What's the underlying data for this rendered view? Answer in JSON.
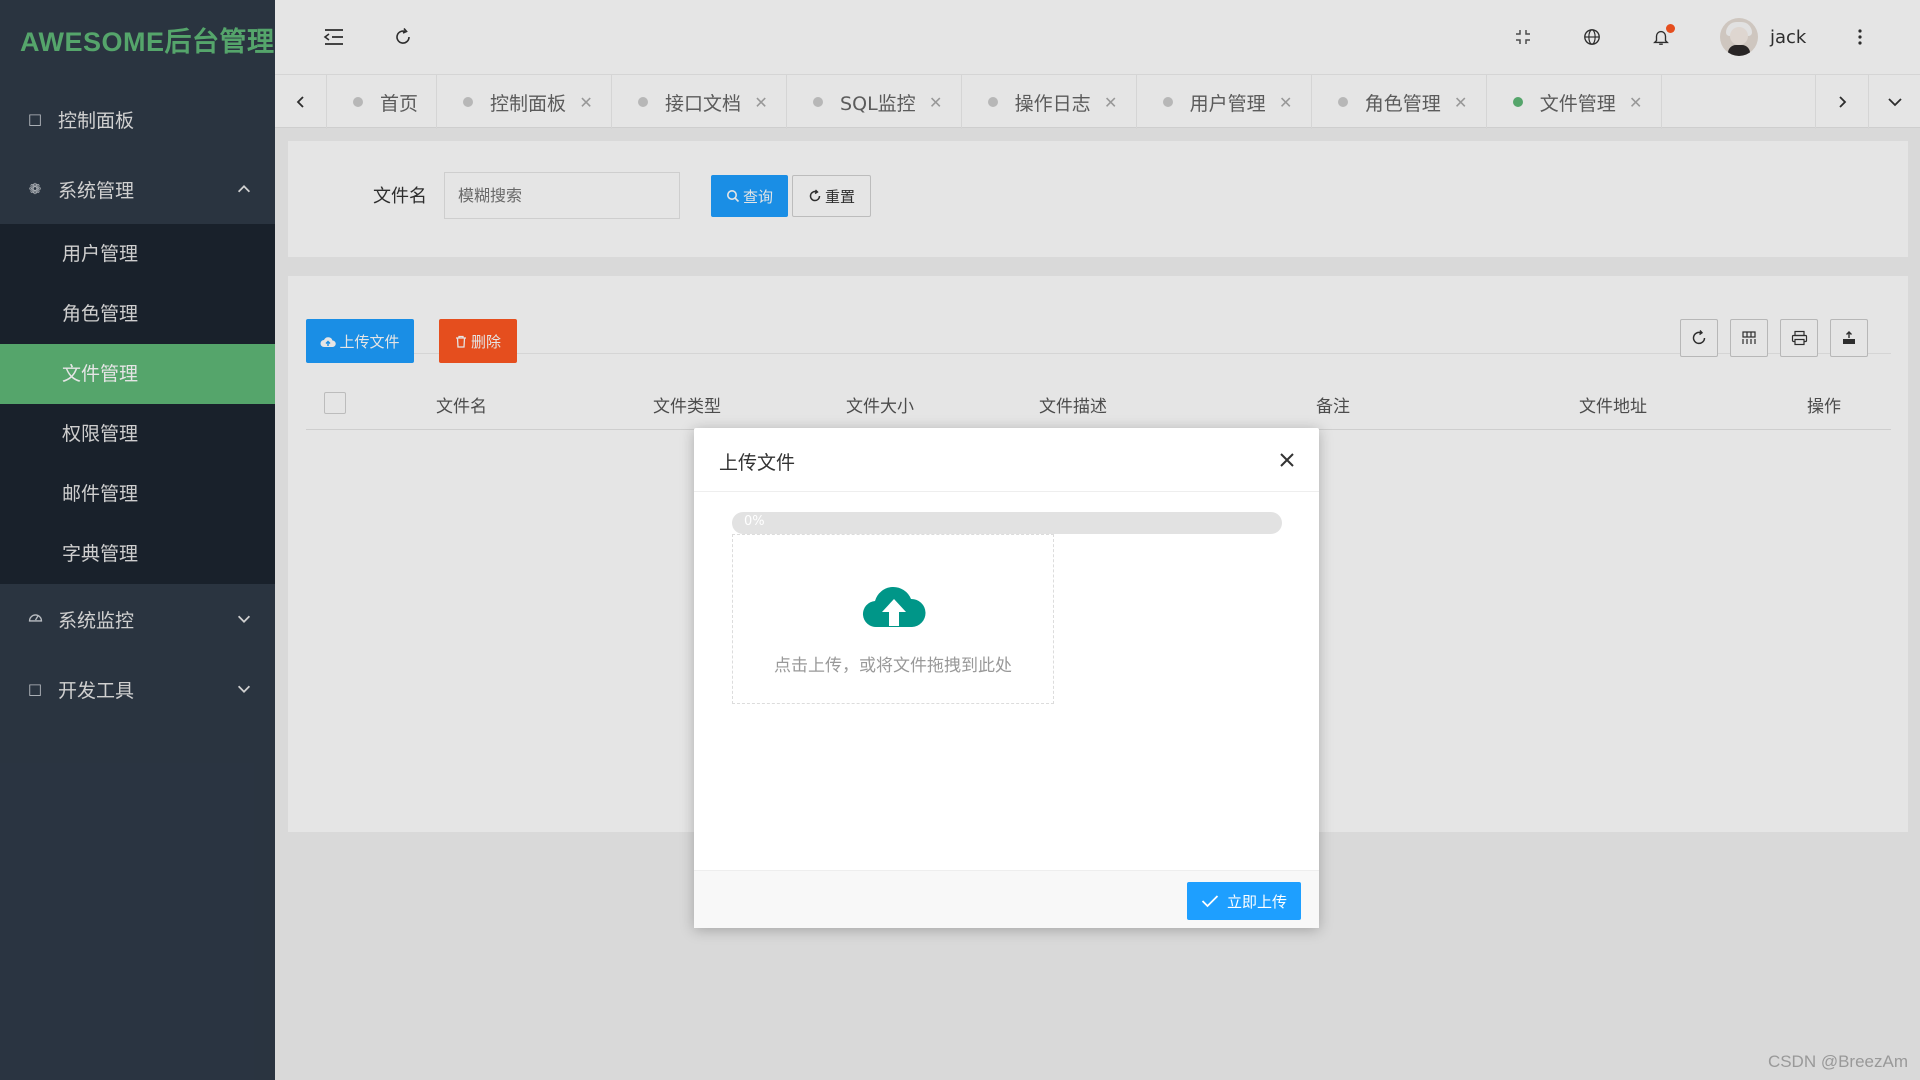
{
  "app": {
    "logo": "AWESOME后台管理"
  },
  "sidebar": {
    "items": [
      {
        "label": "控制面板",
        "icon": "square-icon"
      },
      {
        "label": "系统管理",
        "icon": "gear-icon",
        "expanded": true,
        "children": [
          "用户管理",
          "角色管理",
          "文件管理",
          "权限管理",
          "邮件管理",
          "字典管理"
        ],
        "active_child": "文件管理"
      },
      {
        "label": "系统监控",
        "icon": "dashboard-icon"
      },
      {
        "label": "开发工具",
        "icon": "square-icon"
      }
    ]
  },
  "header": {
    "username": "jack",
    "notification_dot": true
  },
  "tabs": [
    {
      "label": "首页",
      "closable": false
    },
    {
      "label": "控制面板",
      "closable": true
    },
    {
      "label": "接口文档",
      "closable": true
    },
    {
      "label": "SQL监控",
      "closable": true
    },
    {
      "label": "操作日志",
      "closable": true
    },
    {
      "label": "用户管理",
      "closable": true
    },
    {
      "label": "角色管理",
      "closable": true
    },
    {
      "label": "文件管理",
      "closable": true,
      "active": true
    }
  ],
  "search": {
    "label": "文件名",
    "placeholder": "模糊搜索",
    "query_label": "查询",
    "reset_label": "重置"
  },
  "table": {
    "upload_label": "上传文件",
    "delete_label": "删除",
    "columns": [
      "文件名",
      "文件类型",
      "文件大小",
      "文件描述",
      "备注",
      "文件地址",
      "操作"
    ]
  },
  "modal": {
    "title": "上传文件",
    "progress_text": "0%",
    "progress": 0,
    "dropzone_text": "点击上传，或将文件拖拽到此处",
    "submit_label": "立即上传"
  },
  "watermark": "CSDN @BreezAm",
  "colors": {
    "sidebar_bg": "#2f3a48",
    "accent_green": "#5fb878",
    "primary_blue": "#1e9fff",
    "danger": "#ff5722",
    "upload_icon": "#009688"
  }
}
